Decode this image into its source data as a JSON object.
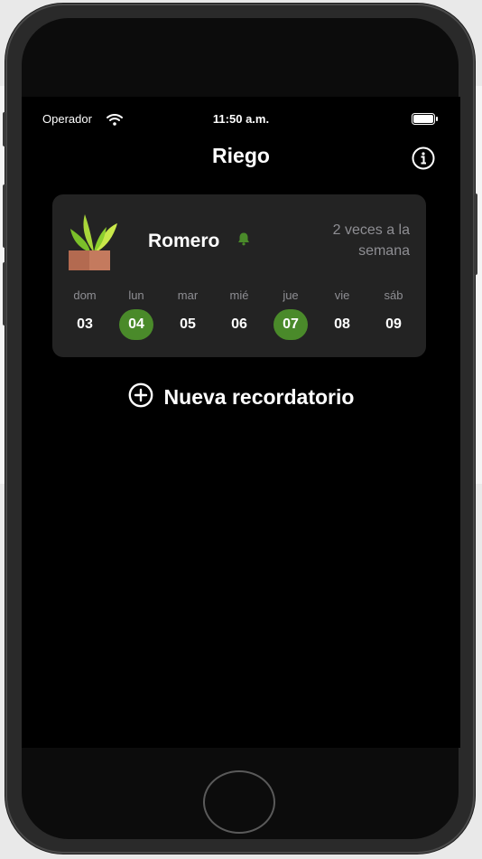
{
  "status_bar": {
    "carrier": "Operador",
    "time": "11:50 a.m."
  },
  "nav": {
    "title": "Riego"
  },
  "plant_card": {
    "name": "Romero",
    "frequency": "2 veces a la semana",
    "days": [
      {
        "name": "dom",
        "number": "03",
        "selected": false
      },
      {
        "name": "lun",
        "number": "04",
        "selected": true
      },
      {
        "name": "mar",
        "number": "05",
        "selected": false
      },
      {
        "name": "mié",
        "number": "06",
        "selected": false
      },
      {
        "name": "jue",
        "number": "07",
        "selected": true
      },
      {
        "name": "vie",
        "number": "08",
        "selected": false
      },
      {
        "name": "sáb",
        "number": "09",
        "selected": false
      }
    ]
  },
  "actions": {
    "new_reminder_label": "Nueva recordatorio"
  },
  "colors": {
    "accent": "#4a8a2a",
    "screen_bg": "#000000",
    "card_bg": "#232323",
    "secondary_text": "#8e8e93"
  },
  "icons": {
    "wifi": "wifi-icon",
    "battery": "battery-icon",
    "info": "info-icon",
    "plant": "plant-icon",
    "bell": "bell-icon",
    "plus": "plus-circle-icon"
  }
}
